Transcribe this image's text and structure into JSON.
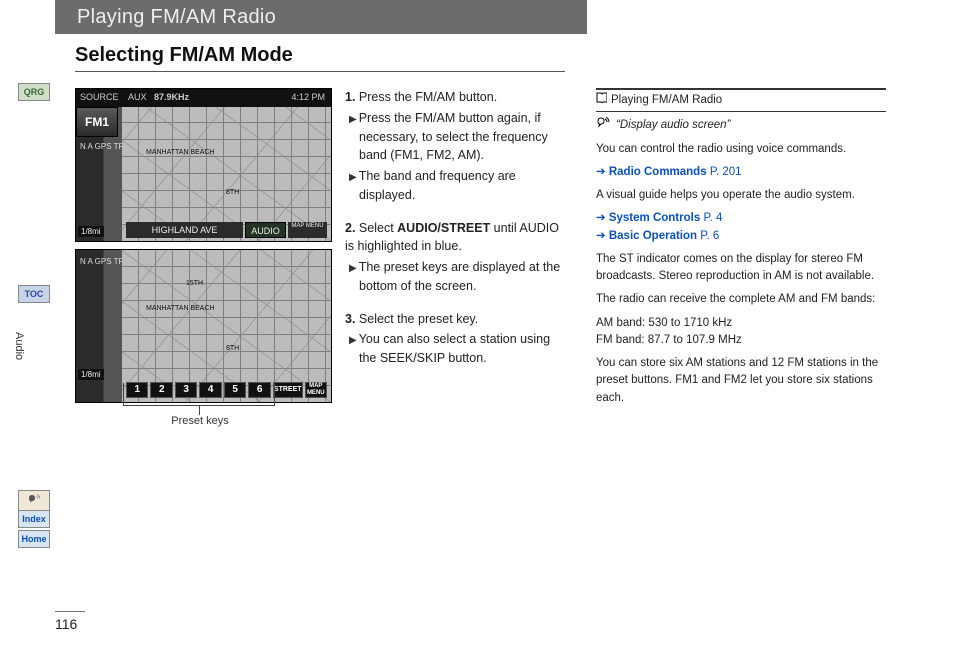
{
  "header": {
    "title": "Playing FM/AM Radio"
  },
  "subheading": "Selecting FM/AM Mode",
  "side": {
    "qrg": "QRG",
    "toc": "TOC",
    "section": "Audio",
    "index": "Index",
    "home": "Home"
  },
  "page_number": "116",
  "screenshot1": {
    "source_label": "SOURCE",
    "aux_label": "AUX",
    "freq": "87.9KHz",
    "clock": "4:12 PM",
    "band": "FM1",
    "gps": "N\nA\nGPS\nTRF",
    "scale": "1/8mi",
    "city": "MANHATTAN BEACH",
    "streets": [
      "8TH",
      "HIGHLAND AVE"
    ],
    "menu_right": "MAP MENU",
    "audio_btn": "AUDIO"
  },
  "screenshot2": {
    "gps": "N\nA\nGPS\nTRF",
    "scale": "1/8mi",
    "city": "MANHATTAN BEACH",
    "st15": "15TH",
    "st8": "8TH",
    "presets": [
      "1",
      "2",
      "3",
      "4",
      "5",
      "6"
    ],
    "street_btn": "STREET",
    "menu_right": "MAP MENU"
  },
  "callout": {
    "preset_keys": "Preset keys"
  },
  "steps": {
    "s1": {
      "num": "1.",
      "text": "Press the FM/AM button.",
      "sub1": "Press the FM/AM button again, if necessary, to select the frequency band (FM1, FM2, AM).",
      "sub2": "The band and frequency are displayed."
    },
    "s2": {
      "num": "2.",
      "text_pre": "Select ",
      "text_bold": "AUDIO/STREET",
      "text_post": " until AUDIO is highlighted in blue.",
      "sub1": "The preset keys are displayed at the bottom of the screen."
    },
    "s3": {
      "num": "3.",
      "text": "Select the preset key.",
      "sub1": "You can also select a station using the SEEK/SKIP button."
    }
  },
  "right": {
    "title": "Playing FM/AM Radio",
    "voice_cmd": "“Display audio screen”",
    "p1": "You can control the radio using voice commands.",
    "link1": "Radio Commands",
    "link1_pg": "P. 201",
    "p2": "A visual guide helps you operate the audio system.",
    "link2": "System Controls",
    "link2_pg": "P. 4",
    "link3": "Basic Operation",
    "link3_pg": "P. 6",
    "p3": "The ST indicator comes on the display for stereo FM broadcasts. Stereo reproduction in AM is not available.",
    "p4": "The radio can receive the complete AM and FM bands:",
    "p5": "AM band: 530 to 1710 kHz",
    "p6": "FM band: 87.7 to 107.9 MHz",
    "p7": "You can store six AM stations and 12 FM stations in the preset buttons. FM1 and FM2 let you store six stations each."
  }
}
